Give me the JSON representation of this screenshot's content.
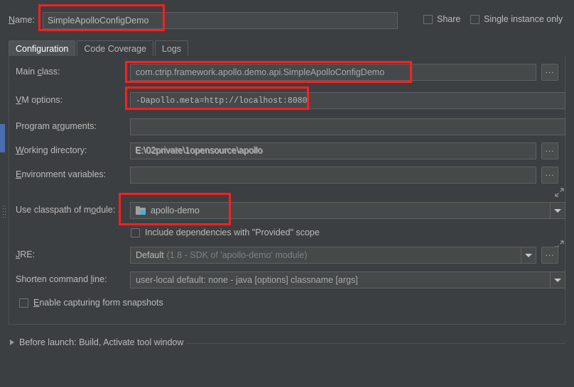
{
  "window": {
    "bg_color": "#3c3f41",
    "accent_color": "#4b6eaf",
    "annotation_color": "#ff1f1f"
  },
  "name_row": {
    "label": "Name:",
    "value": "SimpleApolloConfigDemo",
    "share_label": "Share",
    "single_instance_label": "Single instance only",
    "share_checked": false,
    "single_instance_checked": false
  },
  "tabs": [
    {
      "label": "Configuration",
      "active": true
    },
    {
      "label": "Code Coverage",
      "active": false
    },
    {
      "label": "Logs",
      "active": false
    }
  ],
  "fields": {
    "main_class": {
      "label": "Main class:",
      "value": "com.ctrip.framework.apollo.demo.api.SimpleApolloConfigDemo",
      "browse_label": "..."
    },
    "vm_options": {
      "label": "VM options:",
      "value": "-Dapollo.meta=http://localhost:8080",
      "expand_icon": "expand-arrows-icon"
    },
    "program_arguments": {
      "label": "Program arguments:",
      "value": "",
      "expand_icon": "expand-arrows-icon"
    },
    "working_directory": {
      "label": "Working directory:",
      "value": "E:\\02private\\1opensource\\apollo",
      "browse_label": "..."
    },
    "environment_variables": {
      "label": "Environment variables:",
      "value": "",
      "browse_label": "..."
    },
    "use_classpath_of_module": {
      "label": "Use classpath of module:",
      "value": "apollo-demo",
      "icon": "module-folder-icon"
    },
    "include_provided": {
      "label": "Include dependencies with \"Provided\" scope",
      "checked": false
    },
    "jre": {
      "label": "JRE:",
      "value": "Default",
      "value_hint": "(1.8 - SDK of 'apollo-demo' module)",
      "browse_label": "..."
    },
    "shorten_command_line": {
      "label": "Shorten command line:",
      "value": "user-local default: none - java [options] classname [args]"
    },
    "enable_capturing": {
      "label": "Enable capturing form snapshots",
      "checked": false
    }
  },
  "before_launch": {
    "label": "Before launch: Build, Activate tool window",
    "expand_icon": "triangle-right-icon"
  },
  "annotations": [
    {
      "name": "annotation-name-field"
    },
    {
      "name": "annotation-main-class-field"
    },
    {
      "name": "annotation-vm-options-field"
    },
    {
      "name": "annotation-classpath-module-field"
    }
  ]
}
